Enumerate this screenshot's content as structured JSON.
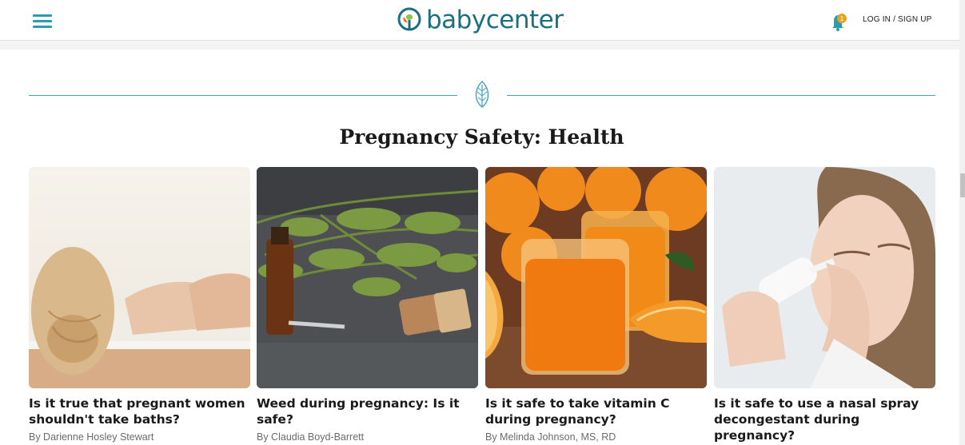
{
  "header": {
    "logo_text": "babycenter",
    "logo_dot": ".",
    "login_label": "LOG IN / SIGN UP",
    "notification_count": "1",
    "brand_color": "#1c6e81",
    "accent_color": "#2a9cb1",
    "bell_color": "#e8a21c"
  },
  "section": {
    "title": "Pregnancy Safety: Health",
    "divider_icon": "leaf-icon"
  },
  "cards": [
    {
      "title": "Is it true that pregnant women shouldn't take baths?",
      "byline": "By Darienne Hosley Stewart",
      "image": "woman-in-bathtub"
    },
    {
      "title": "Weed during pregnancy: Is it safe?",
      "byline": "By Claudia Boyd-Barrett",
      "image": "cannabis-oil-and-vape"
    },
    {
      "title": "Is it safe to take vitamin C during pregnancy?",
      "byline": "By Melinda Johnson, MS, RD",
      "image": "orange-juice-and-oranges"
    },
    {
      "title": "Is it safe to use a nasal spray decongestant during pregnancy?",
      "byline": "",
      "image": "woman-using-nasal-spray"
    }
  ]
}
